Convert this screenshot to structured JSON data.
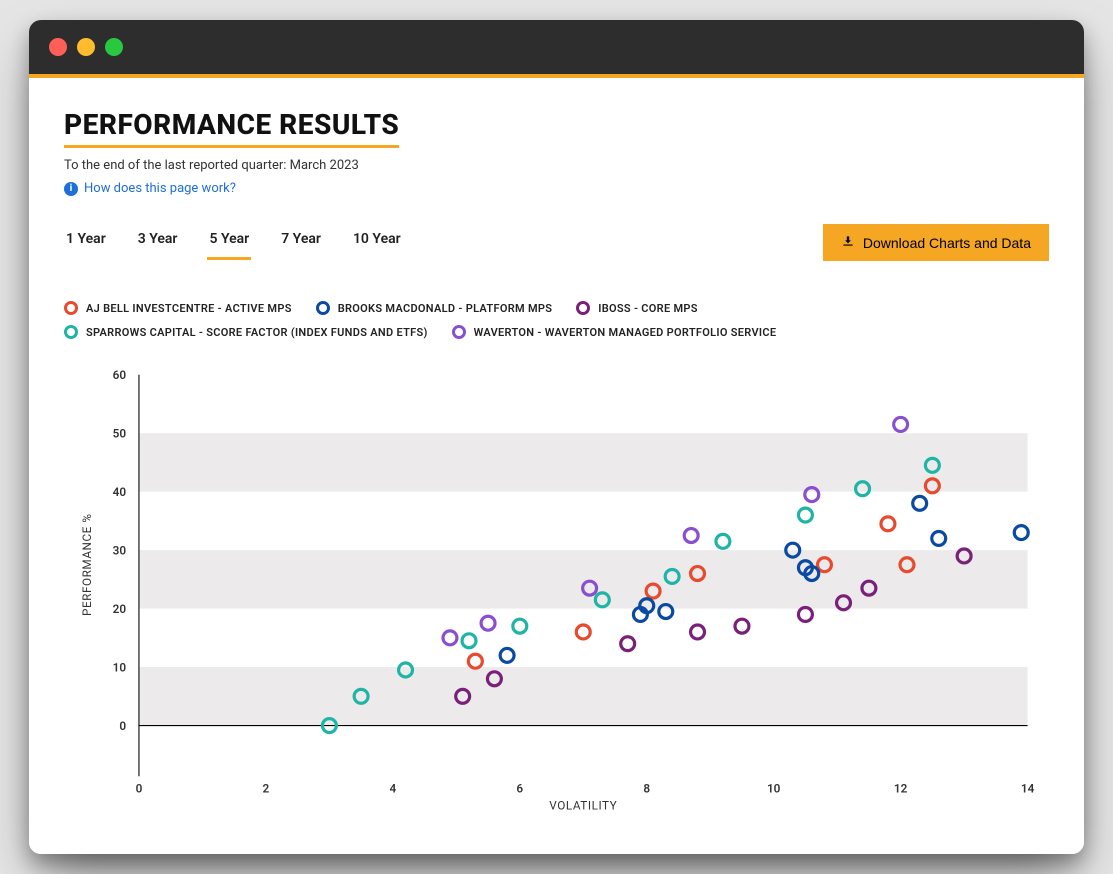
{
  "page": {
    "title": "PERFORMANCE RESULTS",
    "subtitle": "To the end of the last reported quarter: March 2023",
    "help_link": "How does this page work?"
  },
  "tabs": [
    {
      "label": "1 Year",
      "active": false
    },
    {
      "label": "3 Year",
      "active": false
    },
    {
      "label": "5 Year",
      "active": true
    },
    {
      "label": "7 Year",
      "active": false
    },
    {
      "label": "10 Year",
      "active": false
    }
  ],
  "download_button": "Download Charts and Data",
  "legend": [
    {
      "name": "AJ BELL INVESTCENTRE - ACTIVE MPS",
      "color": "#e84a2e"
    },
    {
      "name": "BROOKS MACDONALD - PLATFORM MPS",
      "color": "#0b4aa2"
    },
    {
      "name": "IBOSS - CORE MPS",
      "color": "#7a1f7a"
    },
    {
      "name": "SPARROWS CAPITAL - SCORE FACTOR (INDEX FUNDS AND ETFS)",
      "color": "#1fb5a6"
    },
    {
      "name": "WAVERTON - WAVERTON MANAGED PORTFOLIO SERVICE",
      "color": "#8a4fd1"
    }
  ],
  "chart_data": {
    "type": "scatter",
    "xlabel": "VOLATILITY",
    "ylabel": "PERFORMANCE %",
    "xlim": [
      0,
      14
    ],
    "ylim": [
      -5,
      60
    ],
    "xticks": [
      0,
      2,
      4,
      6,
      8,
      10,
      12,
      14
    ],
    "yticks": [
      0,
      10,
      20,
      30,
      40,
      50,
      60
    ],
    "grid_bands_y": [
      [
        0,
        10
      ],
      [
        20,
        30
      ],
      [
        40,
        50
      ]
    ],
    "series": [
      {
        "name": "AJ BELL INVESTCENTRE - ACTIVE MPS",
        "color": "#e84a2e",
        "points": [
          {
            "x": 5.3,
            "y": 11.0
          },
          {
            "x": 7.0,
            "y": 16.0
          },
          {
            "x": 8.1,
            "y": 23.0
          },
          {
            "x": 8.8,
            "y": 26.0
          },
          {
            "x": 10.8,
            "y": 27.5
          },
          {
            "x": 11.8,
            "y": 34.5
          },
          {
            "x": 12.1,
            "y": 27.5
          },
          {
            "x": 12.5,
            "y": 41.0
          }
        ]
      },
      {
        "name": "BROOKS MACDONALD - PLATFORM MPS",
        "color": "#0b4aa2",
        "points": [
          {
            "x": 5.8,
            "y": 12.0
          },
          {
            "x": 7.9,
            "y": 19.0
          },
          {
            "x": 8.0,
            "y": 20.5
          },
          {
            "x": 8.3,
            "y": 19.5
          },
          {
            "x": 10.3,
            "y": 30.0
          },
          {
            "x": 10.5,
            "y": 27.0
          },
          {
            "x": 10.6,
            "y": 26.0
          },
          {
            "x": 12.3,
            "y": 38.0
          },
          {
            "x": 12.6,
            "y": 32.0
          },
          {
            "x": 13.9,
            "y": 33.0
          }
        ]
      },
      {
        "name": "IBOSS - CORE MPS",
        "color": "#7a1f7a",
        "points": [
          {
            "x": 5.1,
            "y": 5.0
          },
          {
            "x": 5.6,
            "y": 8.0
          },
          {
            "x": 7.7,
            "y": 14.0
          },
          {
            "x": 8.8,
            "y": 16.0
          },
          {
            "x": 9.5,
            "y": 17.0
          },
          {
            "x": 10.5,
            "y": 19.0
          },
          {
            "x": 11.1,
            "y": 21.0
          },
          {
            "x": 11.5,
            "y": 23.5
          },
          {
            "x": 13.0,
            "y": 29.0
          }
        ]
      },
      {
        "name": "SPARROWS CAPITAL - SCORE FACTOR (INDEX FUNDS AND ETFS)",
        "color": "#1fb5a6",
        "points": [
          {
            "x": 3.0,
            "y": 0.0
          },
          {
            "x": 3.5,
            "y": 5.0
          },
          {
            "x": 4.2,
            "y": 9.5
          },
          {
            "x": 5.2,
            "y": 14.5
          },
          {
            "x": 6.0,
            "y": 17.0
          },
          {
            "x": 7.3,
            "y": 21.5
          },
          {
            "x": 8.4,
            "y": 25.5
          },
          {
            "x": 9.2,
            "y": 31.5
          },
          {
            "x": 10.5,
            "y": 36.0
          },
          {
            "x": 11.4,
            "y": 40.5
          },
          {
            "x": 12.5,
            "y": 44.5
          }
        ]
      },
      {
        "name": "WAVERTON - WAVERTON MANAGED PORTFOLIO SERVICE",
        "color": "#8a4fd1",
        "points": [
          {
            "x": 4.9,
            "y": 15.0
          },
          {
            "x": 5.5,
            "y": 17.5
          },
          {
            "x": 7.1,
            "y": 23.5
          },
          {
            "x": 8.7,
            "y": 32.5
          },
          {
            "x": 10.6,
            "y": 39.5
          },
          {
            "x": 12.0,
            "y": 51.5
          }
        ]
      }
    ]
  }
}
